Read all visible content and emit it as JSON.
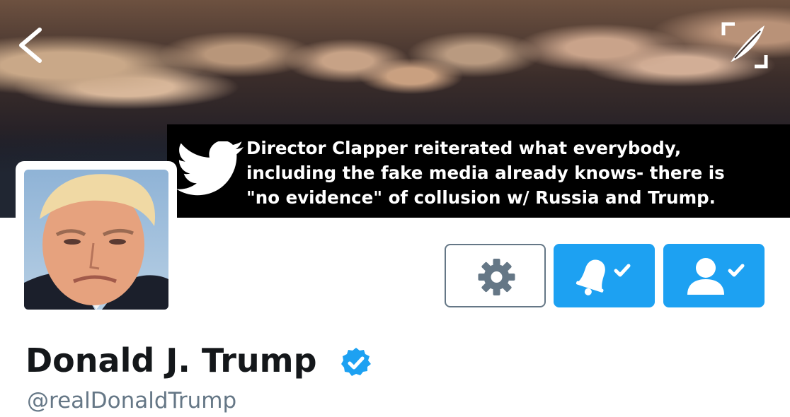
{
  "profile": {
    "name": "Donald J. Trump",
    "handle": "@realDonaldTrump",
    "verified": true
  },
  "banner": {
    "tweet_lines": [
      "Director Clapper reiterated what everybody,",
      "including the fake media already knows- there is",
      "\"no evidence\" of collusion w/ Russia and Trump."
    ]
  },
  "icons": {
    "back": "chevron-left-icon",
    "compose": "compose-feather-icon",
    "bird": "twitter-bird-icon",
    "settings": "gear-icon",
    "notifications": "bell-check-icon",
    "following": "user-check-icon",
    "verified": "verified-badge-icon"
  },
  "colors": {
    "accent": "#1da1f2",
    "name": "#14171a",
    "handle": "#657786",
    "gear_border": "#657786"
  }
}
